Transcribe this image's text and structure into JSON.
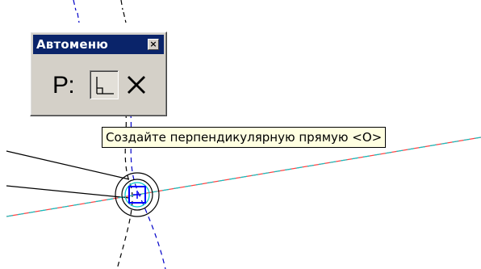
{
  "palette": {
    "title": "Автоменю",
    "close_symbol": "×",
    "mode_label": "Р:",
    "perpendicular_button_icon": "perpendicular-icon",
    "cancel_button_icon": "cross-icon"
  },
  "tooltip": {
    "text": "Создайте перпендикулярную прямую <O>"
  },
  "colors": {
    "titlebar": "#0a246a",
    "panel": "#d4d0c8",
    "tooltip_bg": "#ffffe1",
    "construction_line_red": "#ff4040",
    "construction_line_cyan": "#00c8c8",
    "dashed_blue": "#0000c8",
    "snap_marker": "#0000ff"
  }
}
